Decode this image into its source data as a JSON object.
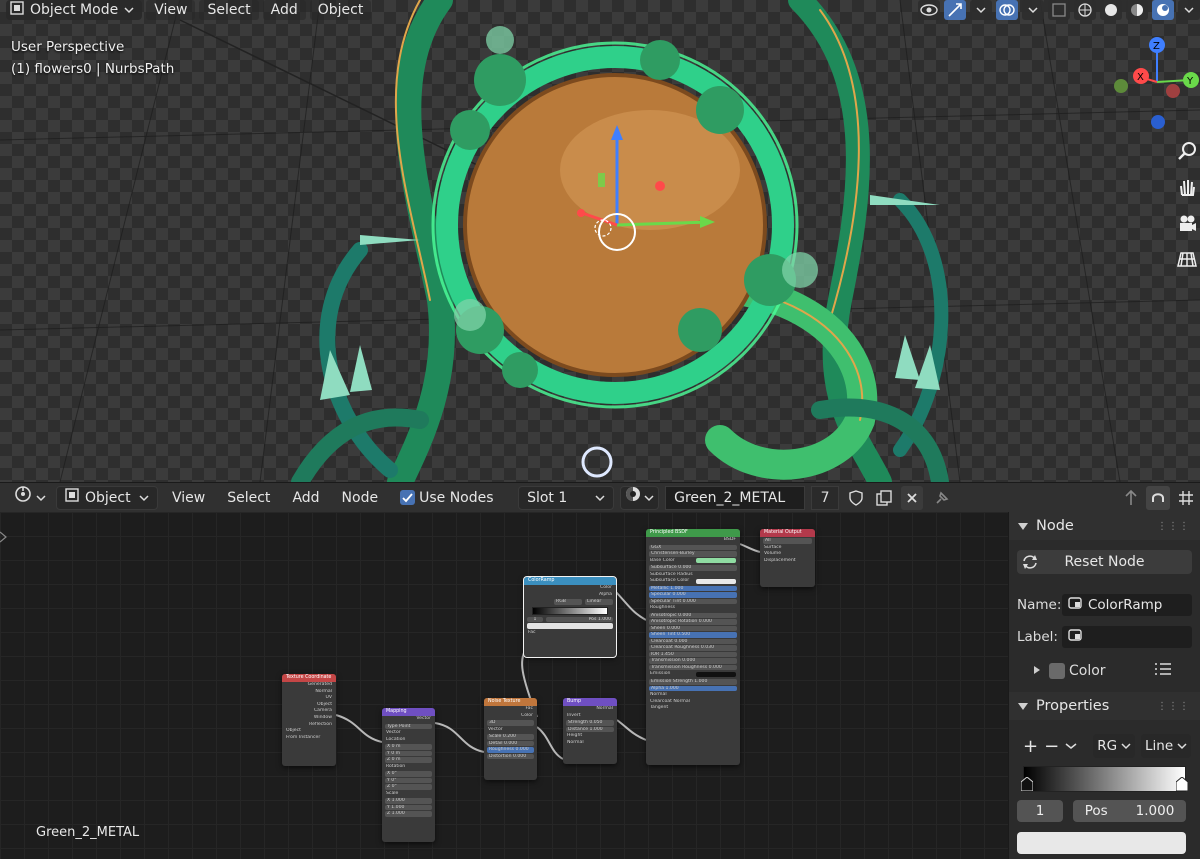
{
  "viewport": {
    "mode_label": "Object Mode",
    "menus": [
      "View",
      "Select",
      "Add",
      "Object"
    ],
    "info_line1": "User Perspective",
    "info_line2": "(1) flowers0 | NurbsPath",
    "gizmo_axes": {
      "z": "Z",
      "x": "X",
      "y": "Y"
    }
  },
  "node_editor_header": {
    "editor_type_icon": "node-editor-icon",
    "object_label": "Object",
    "menus": [
      "View",
      "Select",
      "Add",
      "Node"
    ],
    "use_nodes_label": "Use Nodes",
    "use_nodes_checked": true,
    "slot_label": "Slot 1",
    "material_name": "Green_2_METAL",
    "users_count": "7"
  },
  "canvas": {
    "material_label": "Green_2_METAL"
  },
  "nodes": {
    "tex_coord": {
      "title": "Texture Coordinate",
      "rows": [
        "Generated",
        "Normal",
        "UV",
        "Object",
        "Camera",
        "Window",
        "Reflection"
      ],
      "object_label": "Object",
      "instancer": "From Instancer"
    },
    "mapping": {
      "title": "Mapping",
      "out": "Vector",
      "type_label": "Type",
      "type_value": "Point",
      "vector": "Vector",
      "location": "Location",
      "rotation": "Rotation",
      "scale": "Scale",
      "loc_vals": [
        "0 m",
        "0 m",
        "0 m"
      ],
      "rot_vals": [
        "0°",
        "0°",
        "0°"
      ],
      "scale_vals": [
        "1.000",
        "1.000",
        "1.000"
      ],
      "axes": [
        "X",
        "Y",
        "Z"
      ]
    },
    "noise": {
      "title": "Noise Texture",
      "out1": "Fac",
      "out2": "Color",
      "dim": "3D",
      "vector": "Vector",
      "fields": [
        "Scale  0.200",
        "Detail  0.000",
        "Roughness 0.000",
        "Distortion 0.000"
      ]
    },
    "bump": {
      "title": "Bump",
      "out": "Normal",
      "invert": "Invert",
      "fields": [
        "Strength  0.050",
        "Distance  1.000"
      ],
      "in1": "Height",
      "in2": "Normal"
    },
    "ramp": {
      "title": "ColorRamp",
      "out1": "Color",
      "out2": "Alpha",
      "mode": "RGB",
      "interp": "Linear",
      "idx": "1",
      "pos": "Pos  1.000",
      "fac": "Fac"
    },
    "principled": {
      "title": "Principled BSDF",
      "out": "BSDF",
      "dist": "GGX",
      "sss_method": "Christensen-Burley",
      "rows": [
        "Base Color",
        "Subsurface  0.000",
        "Subsurface Radius",
        "Subsurface Color",
        "Metallic  1.000",
        "Specular  0.000",
        "Specular Tint  0.000",
        "Roughness",
        "Anisotropic  0.000",
        "Anisotropic Rotation  0.000",
        "Sheen  0.000",
        "Sheen Tint  0.500",
        "Clearcoat  0.000",
        "Clearcoat Roughness  0.030",
        "IOR  1.450",
        "Transmission  0.000",
        "Transmission Roughness  0.000",
        "Emission",
        "Emission Strength  1.000",
        "Alpha  1.000",
        "Normal",
        "Clearcoat Normal",
        "Tangent"
      ]
    },
    "output": {
      "title": "Material Output",
      "target": "All",
      "rows": [
        "Surface",
        "Volume",
        "Displacement"
      ]
    }
  },
  "sidebar": {
    "node_section": "Node",
    "reset_label": "Reset Node",
    "name_label": "Name:",
    "name_value": "ColorRamp",
    "label_label": "Label:",
    "label_value": "",
    "color_label": "Color",
    "properties_section": "Properties",
    "color_mode": "RG",
    "interpolation": "Line",
    "stop_index": "1",
    "pos_label": "Pos",
    "pos_value": "1.000"
  }
}
